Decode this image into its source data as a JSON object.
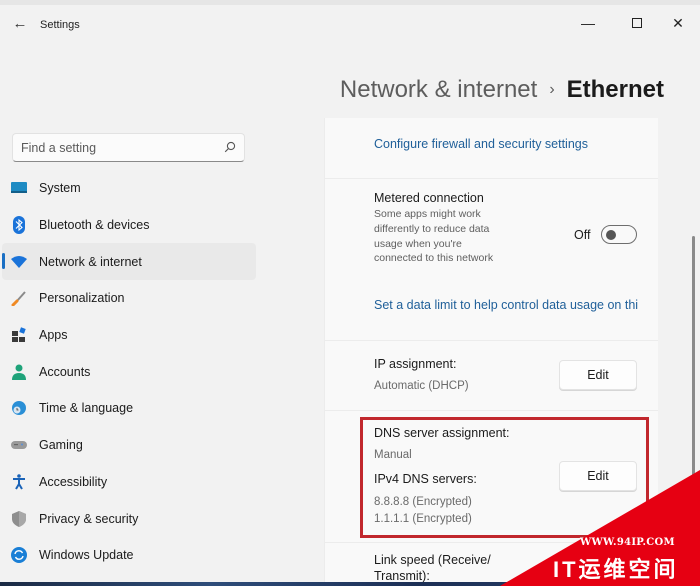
{
  "window": {
    "app_title": "Settings",
    "controls": {
      "minimize": "—",
      "maximize": "",
      "close": "✕"
    },
    "back_icon": "←"
  },
  "header": {
    "breadcrumb_parent": "Network & internet",
    "breadcrumb_separator": "›",
    "breadcrumb_current": "Ethernet"
  },
  "sidebar": {
    "search": {
      "placeholder": "Find a setting",
      "value": ""
    },
    "items": [
      {
        "label": "System",
        "icon": "system-icon",
        "active": false
      },
      {
        "label": "Bluetooth & devices",
        "icon": "bluetooth-icon",
        "active": false
      },
      {
        "label": "Network & internet",
        "icon": "wifi-icon",
        "active": true
      },
      {
        "label": "Personalization",
        "icon": "brush-icon",
        "active": false
      },
      {
        "label": "Apps",
        "icon": "apps-icon",
        "active": false
      },
      {
        "label": "Accounts",
        "icon": "account-icon",
        "active": false
      },
      {
        "label": "Time & language",
        "icon": "globe-clock-icon",
        "active": false
      },
      {
        "label": "Gaming",
        "icon": "gamepad-icon",
        "active": false
      },
      {
        "label": "Accessibility",
        "icon": "accessibility-icon",
        "active": false
      },
      {
        "label": "Privacy & security",
        "icon": "shield-icon",
        "active": false
      },
      {
        "label": "Windows Update",
        "icon": "update-icon",
        "active": false
      }
    ]
  },
  "content": {
    "firewall_link": "Configure firewall and security settings",
    "metered": {
      "title": "Metered connection",
      "description": "Some apps might work differently to reduce data usage when you're connected to this network",
      "toggle_state": "Off",
      "toggle_on": false
    },
    "data_limit_link": "Set a data limit to help control data usage on thi",
    "ip_assignment": {
      "title": "IP assignment:",
      "value": "Automatic (DHCP)",
      "button": "Edit"
    },
    "dns_assignment": {
      "title": "DNS server assignment:",
      "value": "Manual",
      "ipv4_title": "IPv4 DNS servers:",
      "servers": [
        "8.8.8.8 (Encrypted)",
        "1.1.1.1 (Encrypted)"
      ],
      "button": "Edit"
    },
    "link_speed": {
      "title_line1": "Link speed (Receive/",
      "title_line2": "Transmit):"
    }
  },
  "watermark": {
    "url": "WWW.94IP.COM",
    "brand": "IT运维空间",
    "color": "#e60012"
  },
  "colors": {
    "accent": "#1a6fc4",
    "link": "#1f5f99",
    "highlight_border": "#c1272d"
  }
}
